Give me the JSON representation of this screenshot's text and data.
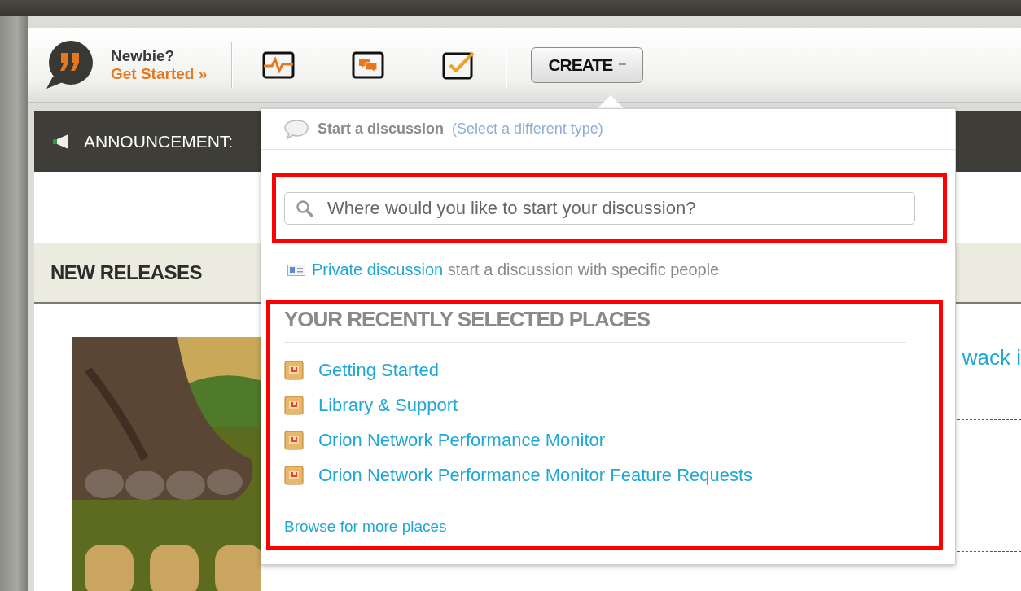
{
  "header": {
    "newbie_label": "Newbie?",
    "get_started": "Get Started »",
    "create_button": "CREATE"
  },
  "announcement": {
    "label": "ANNOUNCEMENT:"
  },
  "new_releases": {
    "title": "NEW RELEASES",
    "link_fragment": "wack i"
  },
  "popup": {
    "type_label": "Start a discussion",
    "change_type": "(Select a different type)",
    "search": {
      "placeholder": "Where would you like to start your discussion?"
    },
    "private_link": "Private discussion",
    "private_text": "start a discussion with specific people",
    "recent_heading": "YOUR RECENTLY SELECTED PLACES",
    "places": [
      {
        "name": "Getting Started"
      },
      {
        "name": "Library & Support"
      },
      {
        "name": "Orion Network Performance Monitor"
      },
      {
        "name": "Orion Network Performance Monitor Feature Requests"
      }
    ],
    "browse_link": "Browse for more places"
  }
}
